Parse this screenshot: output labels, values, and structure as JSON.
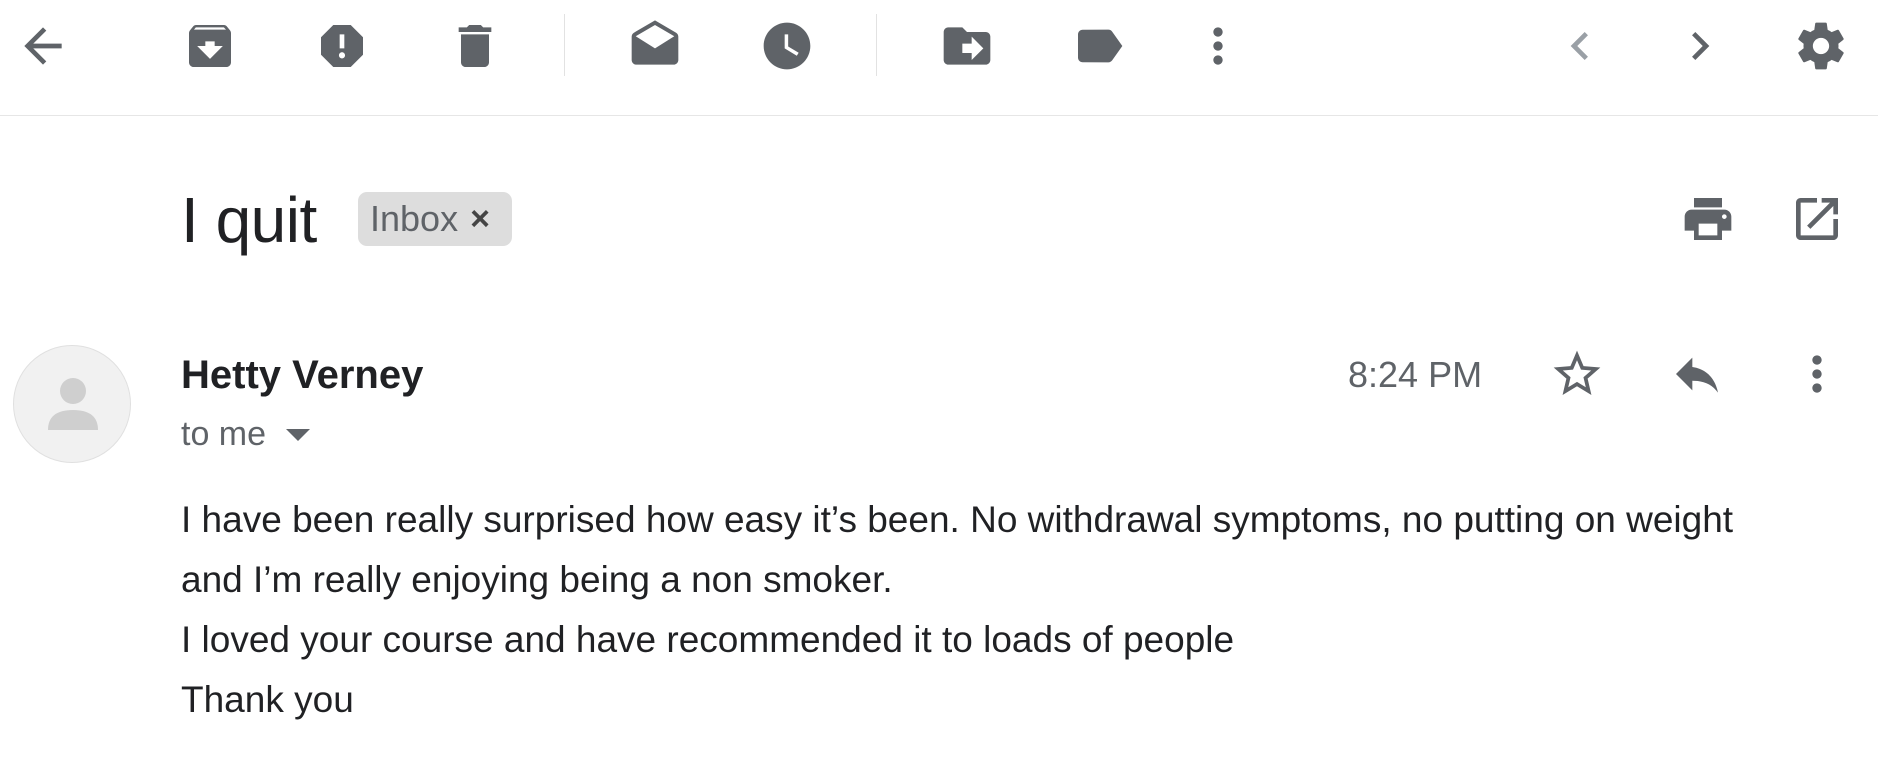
{
  "toolbar": {
    "icons": [
      "back-arrow-icon",
      "archive-icon",
      "report-spam-icon",
      "delete-icon",
      "mark-unread-icon",
      "snooze-icon",
      "move-to-icon",
      "label-icon",
      "more-vert-icon",
      "chevron-left-icon",
      "chevron-right-icon",
      "gear-icon"
    ]
  },
  "email": {
    "subject": "I quit",
    "label_chip": "Inbox",
    "label_remove": "×",
    "sender": "Hetty Verney",
    "recipient": "to me",
    "time": "8:24 PM",
    "body": [
      "I have been really surprised how easy it’s been. No withdrawal symptoms, no putting on weight and I’m really enjoying being a non smoker.",
      "I loved your course and have recommended it to loads of people",
      "Thank you"
    ]
  },
  "colors": {
    "icon": "#5f6368",
    "chip_bg": "#dddddd",
    "avatar_bg": "#f1f1f1"
  }
}
